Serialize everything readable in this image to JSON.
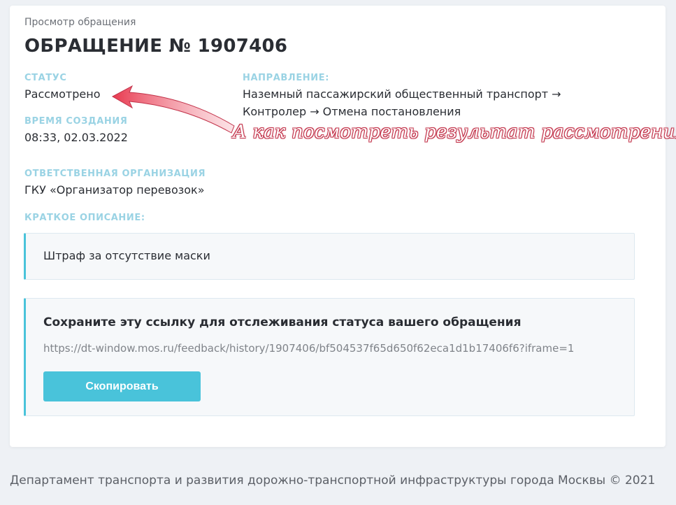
{
  "breadcrumb": "Просмотр обращения",
  "title": "ОБРАЩЕНИЕ № 1907406",
  "status": {
    "label": "СТАТУС",
    "value": "Рассмотрено"
  },
  "created": {
    "label": "ВРЕМЯ СОЗДАНИЯ",
    "value": "08:33, 02.03.2022"
  },
  "direction": {
    "label": "НАПРАВЛЕНИЕ:",
    "line1": "Наземный пассажирский общественный транспорт →",
    "line2": "Контролер → Отмена постановления"
  },
  "organization": {
    "label": "ОТВЕТСТВЕННАЯ ОРГАНИЗАЦИЯ",
    "value": "ГКУ «Организатор перевозок»"
  },
  "description": {
    "label": "КРАТКОЕ ОПИСАНИЕ:",
    "value": "Штраф за отсутствие маски"
  },
  "link_block": {
    "heading": "Сохраните эту ссылку для отслеживания статуса вашего обращения",
    "url": "https://dt-window.mos.ru/feedback/history/1907406/bf504537f65d650f62eca1d1b17406f6?iframe=1",
    "copy_label": "Скопировать"
  },
  "annotation": "А как посмотреть результат рассмотрения?",
  "footer": "Департамент транспорта и развития дорожно-транспортной инфраструктуры города Москвы © 2021",
  "colors": {
    "accent": "#49c3da",
    "label": "#9ad3e4",
    "annotation": "#c2334a"
  }
}
